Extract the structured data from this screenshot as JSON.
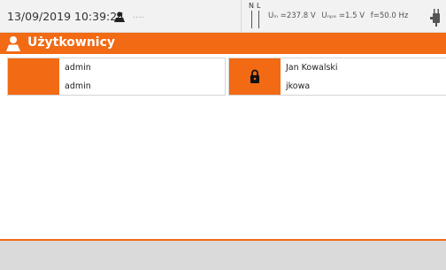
{
  "status": {
    "datetime": "13/09/2019 10:39:24",
    "ellipsis": "....",
    "n_label": "N",
    "l_label": "L",
    "uln": "Uₗₙ =237.8 V",
    "unpe": "Uₙₚₑ =1.5 V",
    "freq": "f=50.0 Hz",
    "icons": [
      "user-icon",
      "plug-icon"
    ]
  },
  "header": {
    "title": "Użytkownicy",
    "icon": "user-icon",
    "accent": "#f26a13"
  },
  "users": [
    {
      "name": "admin",
      "login": "admin",
      "locked": false
    },
    {
      "name": "Jan Kowalski",
      "login": "jkowa",
      "locked": true
    }
  ]
}
